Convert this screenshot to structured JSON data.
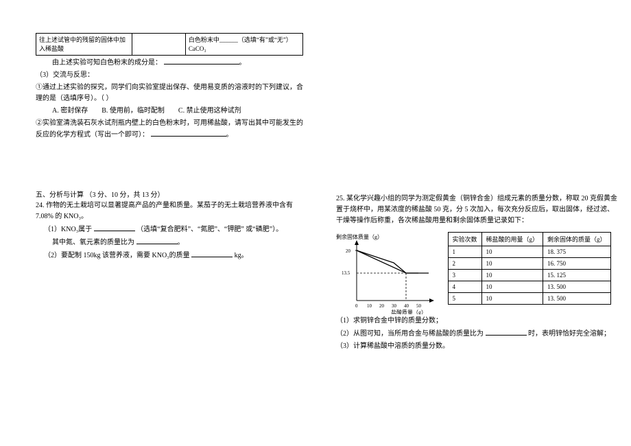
{
  "left": {
    "tbl_r1c1": "往上述试管中的残留的固体中加入稀盐酸",
    "tbl_r1c2": "",
    "tbl_r1c3": "白色粉末中______（选填“有”或“无”）CaCO₃",
    "tbl_concl": "由上述实验可知白色粉末的成分是：",
    "s3_title": "（3）交流与反思：",
    "s3_q1": "①通过上述实验的探究，同学们向实验室提出保存、使用易变质的溶液时的下列建议，合理的是（选填序号）。（    ）",
    "s3_optA": "A. 密封保存",
    "s3_optB": "B. 使用前，临时配制",
    "s3_optC": "C. 禁止使用这种试剂",
    "s3_q2": "②实验室清洗装石灰水试剂瓶内壁上的白色粉末时，可用稀盐酸，请写出其中可能发生的反应的化学方程式（写出一个即可）：",
    "sec5_title": "五、分析与计算  （3 分、10 分，共 13 分）",
    "q24_stem": "24. 作物的无土栽培可以显著提高产品的产量和质量。某茄子的无土栽培营养液中含有 7.08% 的 KNO₃。",
    "q24_1a": "（1）KNO₃属于",
    "q24_1b": "（选填“复合肥料”、“氮肥”、“钾肥”  或“磷肥”）。",
    "q24_1c": "其中氮、氧元素的质量比为",
    "q24_2": "（2）要配制 150kg 该营养液，需要 KNO₃的质量",
    "q24_2u": "kg。"
  },
  "right": {
    "q25_stem": "25. 某化学兴趣小组的同学为测定假黄金（铜锌合金）组成元素的质量分数，称取 20 克假黄金置于烧杯中，用某浓度的稀盐酸 50 克，分 5 次加入，每次充分反应后，取出固体，经过滤、干燥等操作后称重，各次稀盐酸用量和剩余固体质量记录如下：",
    "y_label": "剩余固体质量（g）",
    "x_label": "盐酸质量（g）",
    "th1": "实验次数",
    "th2": "稀盐酸的用量（g）",
    "th3": "剩余固体的质量（g）",
    "r1": {
      "n": "1",
      "a": "10",
      "b": "18. 375"
    },
    "r2": {
      "n": "2",
      "a": "10",
      "b": "16. 750"
    },
    "r3": {
      "n": "3",
      "a": "10",
      "b": "15. 125"
    },
    "r4": {
      "n": "4",
      "a": "10",
      "b": "13. 500"
    },
    "r5": {
      "n": "5",
      "a": "10",
      "b": "13. 500"
    },
    "q25_1": "（1）求铜锌合金中锌的质量分数；",
    "q25_2a": "（2）从图可知，当所用合金与稀盐酸的质量比为",
    "q25_2b": "时，表明锌恰好完全溶解；",
    "q25_3": "（3）计算稀盐酸中溶质的质量分数。"
  },
  "chart_data": {
    "type": "line",
    "title": "",
    "xlabel": "盐酸质量（g）",
    "ylabel": "剩余固体质量（g）",
    "x": [
      0,
      10,
      20,
      30,
      40,
      50
    ],
    "y": [
      20,
      18.375,
      16.75,
      15.125,
      13.5,
      13.5
    ],
    "x_ticks": [
      0,
      10,
      20,
      30,
      40,
      50
    ],
    "y_ticks": [
      13.5,
      20
    ],
    "xlim": [
      0,
      55
    ],
    "ylim": [
      0,
      22
    ],
    "annotations": [
      {
        "type": "dashed-drop",
        "x": 40,
        "y": 13.5
      }
    ]
  }
}
